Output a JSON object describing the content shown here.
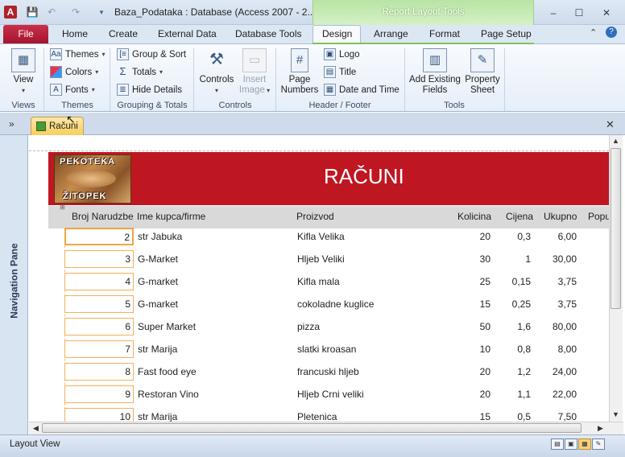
{
  "window": {
    "app_icon": "A",
    "title": "Baza_Podataka : Database (Access 2007 - 2...",
    "contextual_group": "Report Layout Tools",
    "controls": {
      "minimize": "–",
      "maximize": "☐",
      "close": "✕"
    },
    "quick_access": {
      "save_icon": "save-icon",
      "undo_icon": "undo-icon",
      "redo_icon": "redo-icon",
      "customize_icon": "customize-icon"
    }
  },
  "tabs": {
    "file": "File",
    "items": [
      "Home",
      "Create",
      "External Data",
      "Database Tools",
      "Design",
      "Arrange",
      "Format",
      "Page Setup"
    ],
    "active": "Design"
  },
  "ribbon": {
    "views": {
      "view": "View",
      "group": "Views"
    },
    "themes": {
      "themes": "Themes",
      "colors": "Colors",
      "fonts": "Fonts",
      "group": "Themes"
    },
    "grouping": {
      "group_sort": "Group & Sort",
      "totals": "Totals",
      "hide_details": "Hide Details",
      "group": "Grouping & Totals"
    },
    "controls": {
      "controls": "Controls",
      "insert_image_1": "Insert",
      "insert_image_2": "Image",
      "group": "Controls"
    },
    "header_footer": {
      "page_numbers_1": "Page",
      "page_numbers_2": "Numbers",
      "logo": "Logo",
      "title": "Title",
      "date_time": "Date and Time",
      "group": "Header / Footer"
    },
    "tools": {
      "add_fields_1": "Add Existing",
      "add_fields_2": "Fields",
      "prop_sheet_1": "Property",
      "prop_sheet_2": "Sheet",
      "group": "Tools"
    }
  },
  "document": {
    "tab_label": "Računi",
    "close": "✕",
    "nav_toggle": "»",
    "nav_pane": "Navigation Pane"
  },
  "report": {
    "title": "RAČUNI",
    "logo_top": "PEKOTEKA",
    "logo_bottom": "ŽITOPEK",
    "columns": [
      "Broj Narudzbe",
      "Ime kupca/firme",
      "Proizvod",
      "Kolicina",
      "Cijena",
      "Ukupno",
      "Popu"
    ],
    "rows": [
      {
        "broj": "2",
        "kupac": "str Jabuka",
        "proizvod": "Kifla Velika",
        "kolicina": "20",
        "cijena": "0,3",
        "ukupno": "6,00"
      },
      {
        "broj": "3",
        "kupac": "G-Market",
        "proizvod": "Hljeb Veliki",
        "kolicina": "30",
        "cijena": "1",
        "ukupno": "30,00"
      },
      {
        "broj": "4",
        "kupac": "G-market",
        "proizvod": "Kifla mala",
        "kolicina": "25",
        "cijena": "0,15",
        "ukupno": "3,75"
      },
      {
        "broj": "5",
        "kupac": "G-market",
        "proizvod": "cokoladne kuglice",
        "kolicina": "15",
        "cijena": "0,25",
        "ukupno": "3,75"
      },
      {
        "broj": "6",
        "kupac": "Super Market",
        "proizvod": "pizza",
        "kolicina": "50",
        "cijena": "1,6",
        "ukupno": "80,00"
      },
      {
        "broj": "7",
        "kupac": "str Marija",
        "proizvod": "slatki kroasan",
        "kolicina": "10",
        "cijena": "0,8",
        "ukupno": "8,00"
      },
      {
        "broj": "8",
        "kupac": "Fast food eye",
        "proizvod": "francuski hljeb",
        "kolicina": "20",
        "cijena": "1,2",
        "ukupno": "24,00"
      },
      {
        "broj": "9",
        "kupac": "Restoran Vino",
        "proizvod": "Hljeb Crni veliki",
        "kolicina": "20",
        "cijena": "1,1",
        "ukupno": "22,00"
      },
      {
        "broj": "10",
        "kupac": "str Marija",
        "proizvod": "Pletenica",
        "kolicina": "15",
        "cijena": "0,5",
        "ukupno": "7,50"
      }
    ]
  },
  "statusbar": {
    "text": "Layout View"
  }
}
